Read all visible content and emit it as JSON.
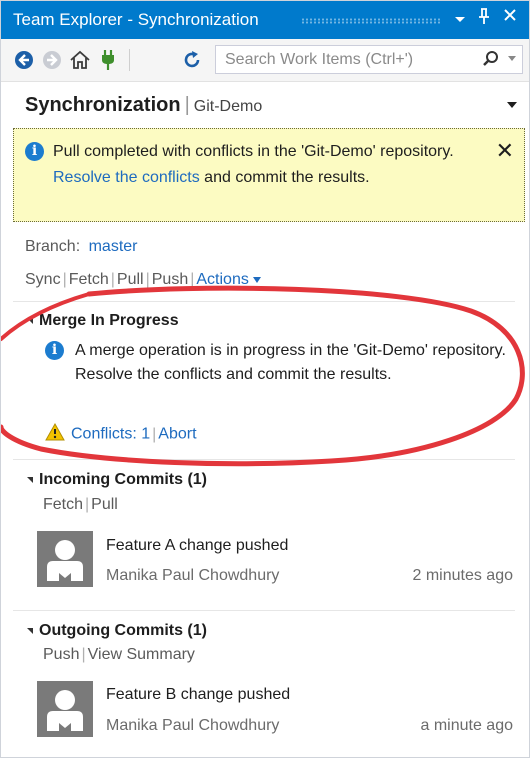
{
  "window": {
    "title": "Team Explorer - Synchronization",
    "pin_glyph": "ᴪ",
    "close_glyph": "✕"
  },
  "toolbar": {
    "search_placeholder": "Search Work Items (Ctrl+')"
  },
  "header": {
    "title": "Synchronization",
    "repo": "Git-Demo"
  },
  "notice": {
    "text_before": "Pull completed with conflicts in the 'Git-Demo' repository. ",
    "link": "Resolve the conflicts",
    "text_after": " and commit the results."
  },
  "branch": {
    "label": "Branch:",
    "name": "master"
  },
  "actions": {
    "sync": "Sync",
    "fetch": "Fetch",
    "pull": "Pull",
    "push": "Push",
    "actions": "Actions"
  },
  "merge": {
    "title": "Merge In Progress",
    "text": "A merge operation is in progress in the 'Git-Demo' repository. Resolve the conflicts and commit the results.",
    "conflicts": "Conflicts: 1",
    "abort": "Abort"
  },
  "incoming": {
    "title": "Incoming Commits (1)",
    "fetch": "Fetch",
    "pull": "Pull",
    "commit": {
      "message": "Feature A change pushed",
      "author": "Manika Paul Chowdhury",
      "time": "2 minutes ago"
    }
  },
  "outgoing": {
    "title": "Outgoing Commits (1)",
    "push": "Push",
    "summary": "View Summary",
    "commit": {
      "message": "Feature B change pushed",
      "author": "Manika Paul Chowdhury",
      "time": "a minute ago"
    }
  },
  "colors": {
    "accent": "#007acc",
    "link": "#1e6bbf",
    "notice_bg": "#fcfbc2",
    "annotation": "#e2363b"
  }
}
